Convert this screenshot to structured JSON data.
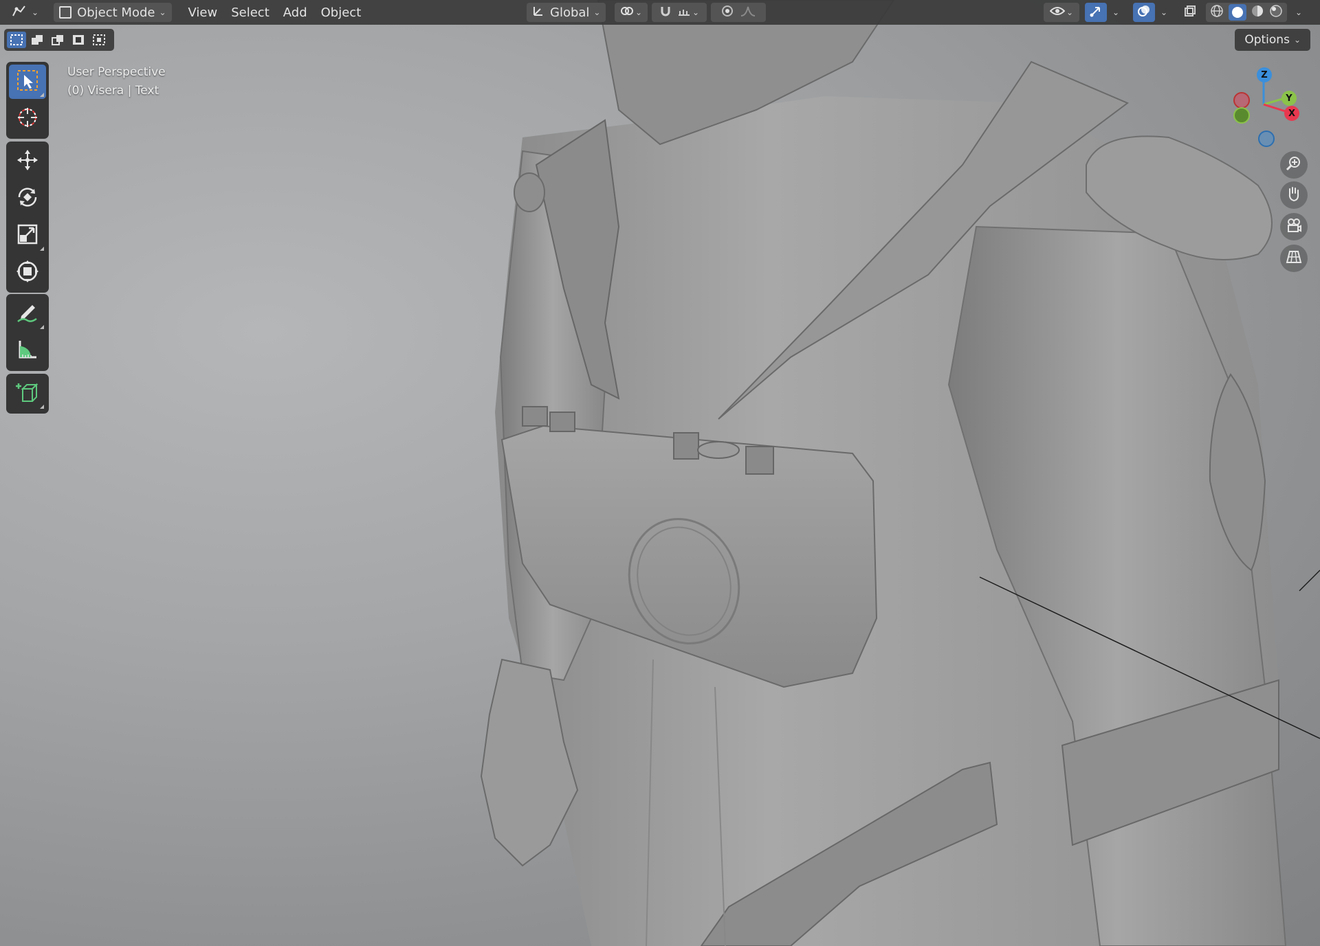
{
  "header": {
    "editor_type_icon": "viewport-editor-icon",
    "mode": "Object Mode",
    "menus": [
      "View",
      "Select",
      "Add",
      "Object"
    ],
    "transform_orientation": "Global"
  },
  "options_label": "Options",
  "viewport_info": {
    "perspective": "User Perspective",
    "object": "(0) Visera | Text"
  },
  "gizmo": {
    "z": "Z",
    "y": "Y",
    "x": "X"
  },
  "colors": {
    "accent": "#4772b3",
    "axis_x": "#e8384f",
    "axis_y": "#8bc34a",
    "axis_z": "#3b8fdc"
  },
  "tools": [
    "select-box",
    "cursor",
    "move",
    "rotate",
    "scale",
    "transform",
    "annotate",
    "measure",
    "add-cube"
  ],
  "nav_controls": [
    "zoom",
    "pan",
    "camera",
    "perspective-toggle"
  ]
}
